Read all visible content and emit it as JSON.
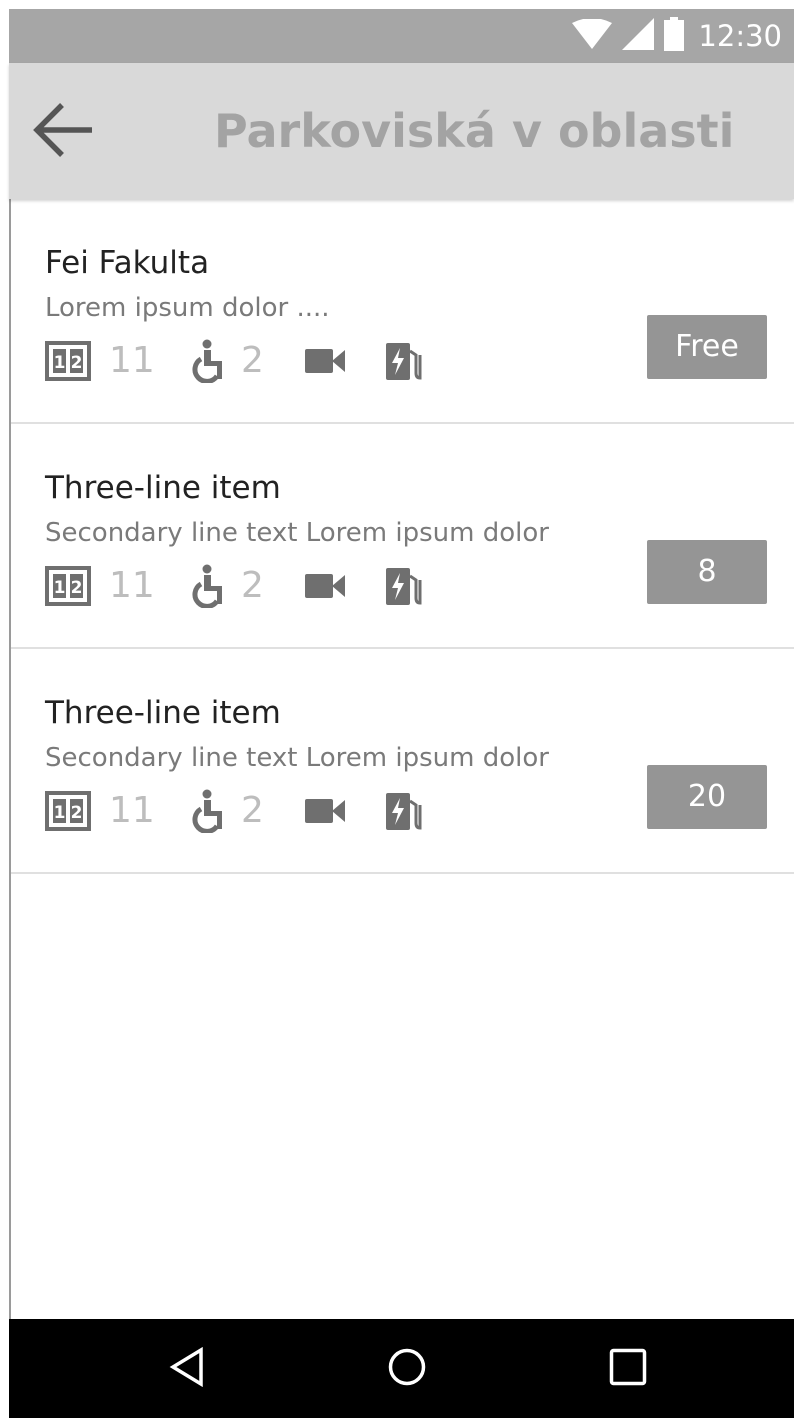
{
  "status_bar": {
    "time": "12:30",
    "icons": [
      "wifi-icon",
      "cellular-signal-icon",
      "battery-icon"
    ]
  },
  "app_bar": {
    "back_icon": "arrow-back-icon",
    "title": "Parkoviská v oblasti"
  },
  "list": {
    "items": [
      {
        "title": "Fei Fakulta",
        "subtitle": "Lorem ipsum dolor ....",
        "spots_count": "11",
        "accessible_count": "2",
        "badge": "Free"
      },
      {
        "title": "Three-line item",
        "subtitle": "Secondary line text Lorem ipsum dolor",
        "spots_count": "11",
        "accessible_count": "2",
        "badge": "8"
      },
      {
        "title": "Three-line item",
        "subtitle": "Secondary line text Lorem ipsum dolor",
        "spots_count": "11",
        "accessible_count": "2",
        "badge": "20"
      }
    ],
    "meta_icons": [
      "parking-spots-icon",
      "wheelchair-icon",
      "video-camera-icon",
      "ev-charging-icon"
    ]
  },
  "nav_bar": {
    "buttons": [
      "back-triangle-icon",
      "home-circle-icon",
      "recents-square-icon"
    ]
  },
  "colors": {
    "status_bar_bg": "#a6a6a6",
    "app_bar_bg": "#d9d9d9",
    "title_text": "#a3a3a3",
    "badge_bg": "#959595",
    "icon_gray": "#6f6f6f",
    "count_gray": "#bdbdbd",
    "nav_bar_bg": "#000000"
  }
}
